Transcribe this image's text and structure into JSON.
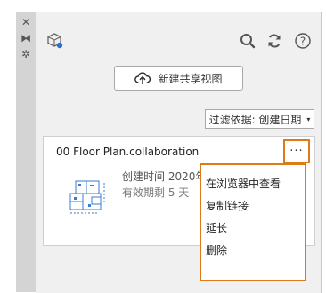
{
  "sidebar": {
    "items": [
      {
        "icon": "close-icon",
        "glyph": "✕"
      },
      {
        "icon": "dock-icon",
        "glyph": "⧓"
      },
      {
        "icon": "settings-icon",
        "glyph": "✲"
      }
    ]
  },
  "header": {
    "logo_icon": "shared-views-logo-icon",
    "search_icon": "search-icon",
    "refresh_icon": "refresh-icon",
    "help_icon": "help-icon",
    "help_glyph": "?"
  },
  "toolbar": {
    "new_view_label": "新建共享视图",
    "new_view_icon": "cloud-upload-icon"
  },
  "filter": {
    "label": "过滤依据: 创建日期",
    "caret": "▾"
  },
  "view_card": {
    "title": "00 Floor Plan.collaboration",
    "created": "创建时间 2020年",
    "expires": "有效期剩 5 天",
    "more_label": "···"
  },
  "context_menu": {
    "items": [
      {
        "label": "在浏览器中查看"
      },
      {
        "label": "复制链接"
      },
      {
        "label": "延长"
      },
      {
        "label": "删除"
      }
    ]
  },
  "colors": {
    "highlight": "#e07a17",
    "logo_blue": "#2d6fd1",
    "panel_bg": "#f0f0f0"
  }
}
